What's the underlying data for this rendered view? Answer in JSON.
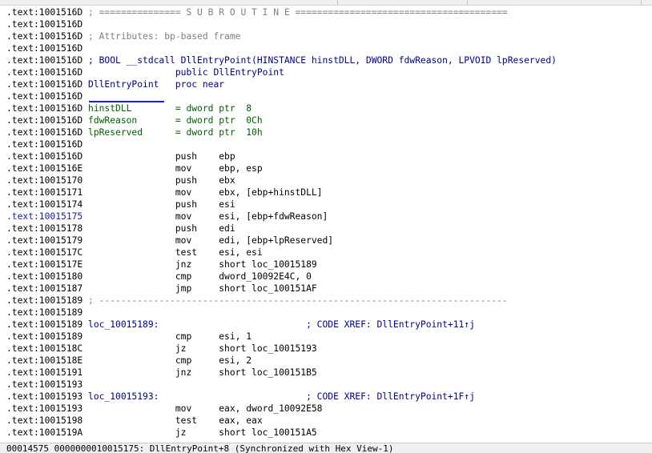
{
  "lines": [
    {
      "addr": ".text:1001516D",
      "text": " ; =============== S U B R O U T I N E =======================================",
      "cls": "cmt"
    },
    {
      "addr": ".text:1001516D",
      "text": "",
      "cls": "code"
    },
    {
      "addr": ".text:1001516D",
      "text": " ; Attributes: bp-based frame",
      "cls": "cmt"
    },
    {
      "addr": ".text:1001516D",
      "text": "",
      "cls": "code"
    },
    {
      "addr": ".text:1001516D",
      "text": " ; BOOL __stdcall DllEntryPoint(HINSTANCE hinstDLL, DWORD fdwReason, LPVOID lpReserved)",
      "cls": "kw"
    },
    {
      "addr": ".text:1001516D",
      "text": "                 public DllEntryPoint",
      "cls": "kw"
    },
    {
      "addr": ".text:1001516D",
      "text": " DllEntryPoint   proc near",
      "cls": "kw"
    },
    {
      "addr": ".text:1001516D",
      "text": "",
      "cls": "code",
      "underline": true
    },
    {
      "addr": ".text:1001516D",
      "text": " hinstDLL        = dword ptr  8",
      "cls": "var"
    },
    {
      "addr": ".text:1001516D",
      "text": " fdwReason       = dword ptr  0Ch",
      "cls": "var"
    },
    {
      "addr": ".text:1001516D",
      "text": " lpReserved      = dword ptr  10h",
      "cls": "var"
    },
    {
      "addr": ".text:1001516D",
      "text": "",
      "cls": "code"
    },
    {
      "addr": ".text:1001516D",
      "text": "                 push    ebp",
      "cls": "code"
    },
    {
      "addr": ".text:1001516E",
      "text": "                 mov     ebp, esp",
      "cls": "code"
    },
    {
      "addr": ".text:10015170",
      "text": "                 push    ebx",
      "cls": "code"
    },
    {
      "addr": ".text:10015171",
      "text": "                 mov     ebx, [ebp+hinstDLL]",
      "cls": "code"
    },
    {
      "addr": ".text:10015174",
      "text": "                 push    esi",
      "cls": "code"
    },
    {
      "addr": ".text:10015175",
      "text": "                 mov     esi, [ebp+fdwReason]",
      "cls": "code",
      "hl": true
    },
    {
      "addr": ".text:10015178",
      "text": "                 push    edi",
      "cls": "code"
    },
    {
      "addr": ".text:10015179",
      "text": "                 mov     edi, [ebp+lpReserved]",
      "cls": "code"
    },
    {
      "addr": ".text:1001517C",
      "text": "                 test    esi, esi",
      "cls": "code"
    },
    {
      "addr": ".text:1001517E",
      "text": "                 jnz     short loc_10015189",
      "cls": "code"
    },
    {
      "addr": ".text:10015180",
      "text": "                 cmp     dword_10092E4C, 0",
      "cls": "code"
    },
    {
      "addr": ".text:10015187",
      "text": "                 jmp     short loc_100151AF",
      "cls": "code"
    },
    {
      "addr": ".text:10015189",
      "text": " ; ---------------------------------------------------------------------------",
      "cls": "cmt"
    },
    {
      "addr": ".text:10015189",
      "text": "",
      "cls": "code"
    },
    {
      "addr": ".text:10015189",
      "text": " loc_10015189:                           ; CODE XREF: DllEntryPoint+11↑j",
      "cls": "xref"
    },
    {
      "addr": ".text:10015189",
      "text": "                 cmp     esi, 1",
      "cls": "code"
    },
    {
      "addr": ".text:1001518C",
      "text": "                 jz      short loc_10015193",
      "cls": "code"
    },
    {
      "addr": ".text:1001518E",
      "text": "                 cmp     esi, 2",
      "cls": "code"
    },
    {
      "addr": ".text:10015191",
      "text": "                 jnz     short loc_100151B5",
      "cls": "code"
    },
    {
      "addr": ".text:10015193",
      "text": "",
      "cls": "code"
    },
    {
      "addr": ".text:10015193",
      "text": " loc_10015193:                           ; CODE XREF: DllEntryPoint+1F↑j",
      "cls": "xref"
    },
    {
      "addr": ".text:10015193",
      "text": "                 mov     eax, dword_10092E58",
      "cls": "code"
    },
    {
      "addr": ".text:10015198",
      "text": "                 test    eax, eax",
      "cls": "code"
    },
    {
      "addr": ".text:1001519A",
      "text": "                 jz      short loc_100151A5",
      "cls": "code"
    }
  ],
  "status": {
    "text": "00014575 0000000010015175: DllEntryPoint+8 (Synchronized with Hex View-1)"
  }
}
